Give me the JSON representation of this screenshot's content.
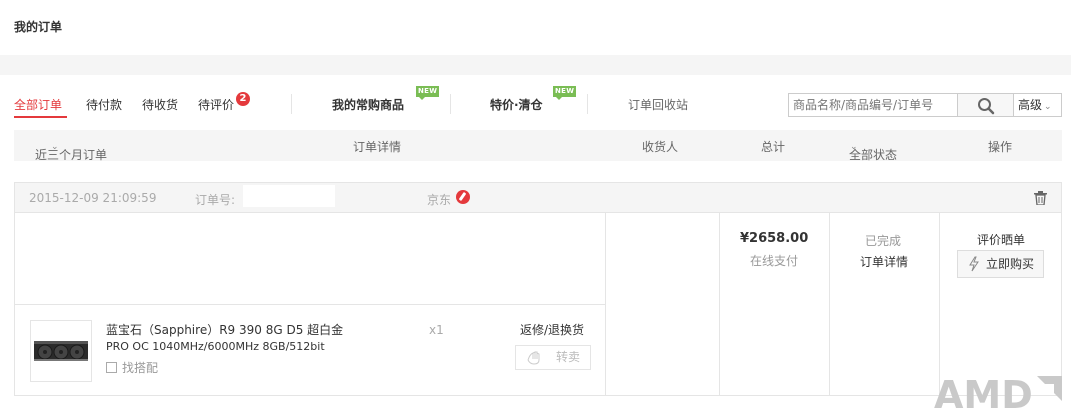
{
  "page": {
    "title": "我的订单"
  },
  "tabs": {
    "all": "全部订单",
    "pending_payment": "待付款",
    "pending_receipt": "待收货",
    "pending_review": "待评价",
    "pending_review_count": "2",
    "frequent": "我的常购商品",
    "frequent_badge": "NEW",
    "special": "特价·清仓",
    "special_badge": "NEW",
    "recycle": "订单回收站"
  },
  "search": {
    "placeholder": "商品名称/商品编号/订单号",
    "advanced_label": "高级"
  },
  "table_header": {
    "range": "近三个月订单",
    "detail": "订单详情",
    "receiver": "收货人",
    "total": "总计",
    "status": "全部状态",
    "action": "操作"
  },
  "order": {
    "datetime": "2015-12-09 21:09:59",
    "order_no_label": "订单号:",
    "shop": "京东",
    "product": {
      "name_line1": "蓝宝石（Sapphire）R9 390 8G D5 超白金",
      "name_line2": "PRO OC 1040MHz/6000MHz 8GB/512bit",
      "match_label": "找搭配",
      "quantity": "x1",
      "after_sale": "返修/退换货",
      "resell": "转卖"
    },
    "price": "¥2658.00",
    "payment": "在线支付",
    "status": "已完成",
    "detail_link": "订单详情",
    "review_link": "评价晒单",
    "buy_again": "立即购买"
  },
  "watermark": {
    "text": "AMD"
  },
  "colors": {
    "accent": "#e4393c",
    "new_badge": "#7abd54",
    "header_bg": "#f5f5f5",
    "border": "#e5e5e5"
  }
}
